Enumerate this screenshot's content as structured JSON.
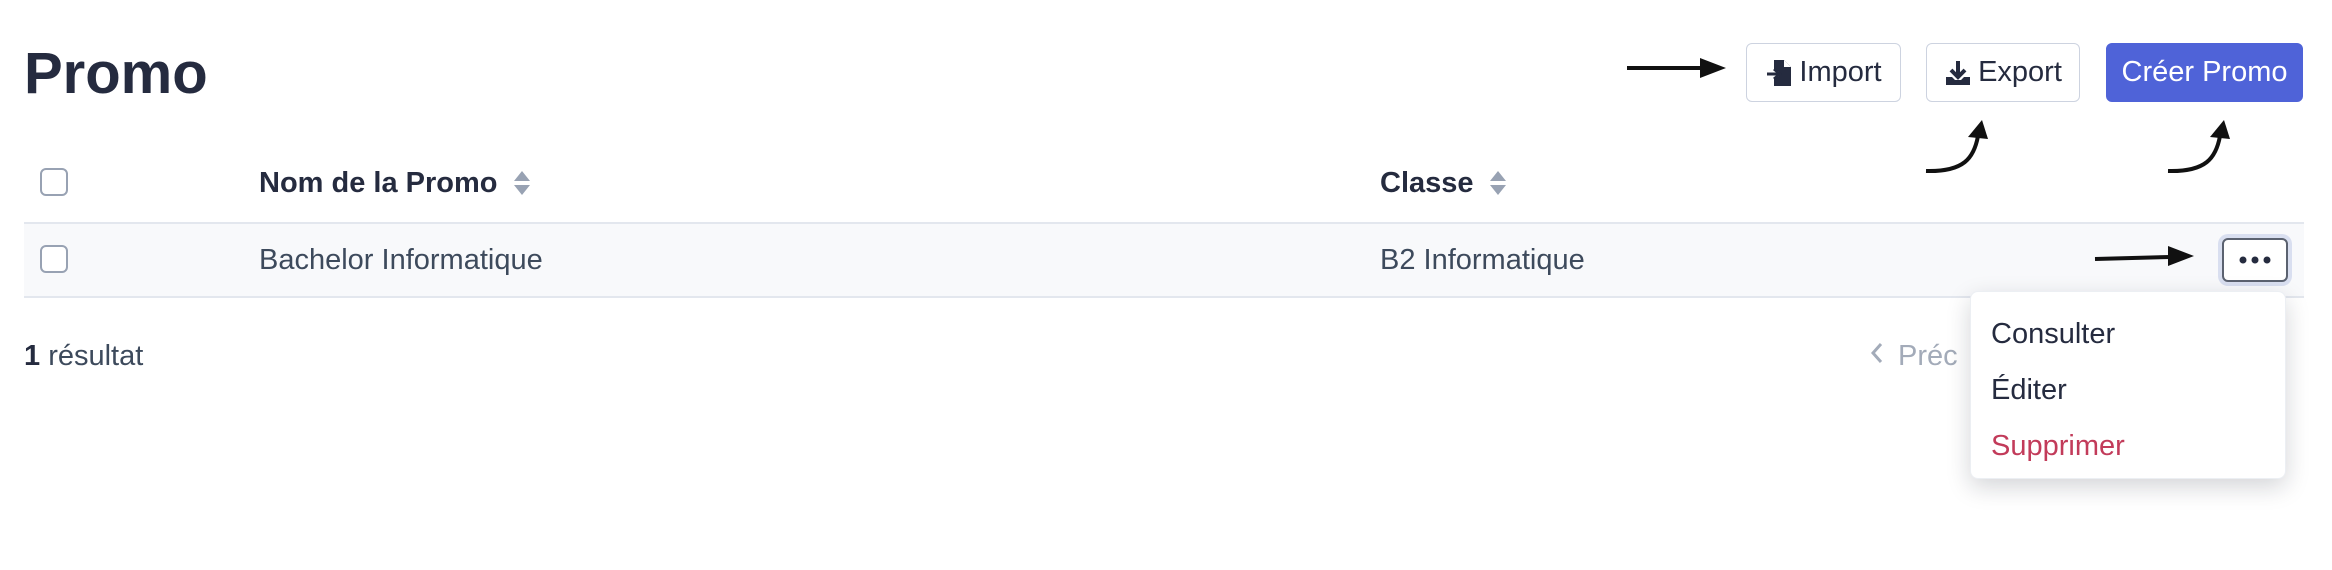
{
  "page": {
    "title": "Promo"
  },
  "actions": {
    "import_label": "Import",
    "export_label": "Export",
    "create_label": "Créer Promo"
  },
  "table": {
    "columns": [
      "Nom de la Promo",
      "Classe"
    ],
    "rows": [
      {
        "nom": "Bachelor Informatique",
        "classe": "B2 Informatique"
      }
    ]
  },
  "footer": {
    "results_count": "1",
    "results_label": "résultat",
    "prev_label": "Préc"
  },
  "row_menu": {
    "items": [
      {
        "label": "Consulter"
      },
      {
        "label": "Éditer"
      },
      {
        "label": "Supprimer"
      }
    ]
  },
  "colors": {
    "primary": "#4f63d8",
    "danger": "#c23b5a",
    "title": "#252b3f"
  },
  "icons": {
    "import": "file-import-icon",
    "export": "download-icon",
    "sort": "sort-icon",
    "more": "ellipsis-icon",
    "prev": "chevron-left-icon"
  }
}
